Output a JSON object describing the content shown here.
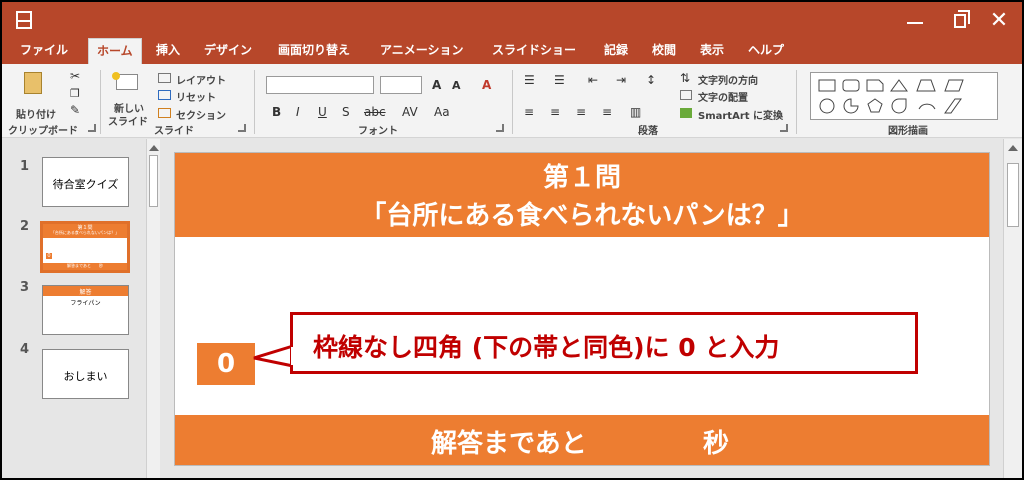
{
  "window": {
    "close_glyph": "✕"
  },
  "tabs": [
    {
      "label": "ファイル",
      "active": false
    },
    {
      "label": "ホーム",
      "active": true
    },
    {
      "label": "挿入",
      "active": false
    },
    {
      "label": "デザイン",
      "active": false
    },
    {
      "label": "画面切り替え",
      "active": false
    },
    {
      "label": "アニメーション",
      "active": false
    },
    {
      "label": "スライドショー",
      "active": false
    },
    {
      "label": "記録",
      "active": false
    },
    {
      "label": "校閲",
      "active": false
    },
    {
      "label": "表示",
      "active": false
    },
    {
      "label": "ヘルプ",
      "active": false
    }
  ],
  "ribbon": {
    "clipboard": {
      "paste_label": "貼り付け",
      "group_label": "クリップボード"
    },
    "slides": {
      "new_slide_line1": "新しい",
      "new_slide_line2": "スライド",
      "layout_label": "レイアウト",
      "reset_label": "リセット",
      "section_label": "セクション",
      "group_label": "スライド"
    },
    "font": {
      "grow_label": "A",
      "shrink_label": "A",
      "clear_label": "A",
      "bold": "B",
      "italic": "I",
      "underline": "U",
      "shadow": "S",
      "strike": "abc",
      "spacing": "AV",
      "case": "Aa",
      "group_label": "フォント"
    },
    "paragraph": {
      "text_direction_label": "文字列の方向",
      "align_text_label": "文字の配置",
      "smartart_label": "SmartArt に変換",
      "group_label": "段落"
    },
    "drawing": {
      "group_label": "図形描画"
    }
  },
  "thumbnails": [
    {
      "num": "1",
      "text": "待合室クイズ"
    },
    {
      "num": "2",
      "title": "第１問",
      "subtitle": "「台所にある食べられないパンは？」",
      "box": "0",
      "footer": "解答まであと　　秒"
    },
    {
      "num": "3",
      "title": "解答",
      "text": "フライパン"
    },
    {
      "num": "4",
      "text": "おしまい"
    }
  ],
  "slide": {
    "title_line1": "第１問",
    "title_line2": "「台所にある食べられないパンは？」",
    "zero_value": "0",
    "footer_text": "解答まであと",
    "footer_unit": "秒",
    "accent_color": "#ed7d31"
  },
  "callout": {
    "text": "枠線なし四角 (下の帯と同色)に 0 と入力",
    "color": "#c00000"
  },
  "colors": {
    "title_bar": "#b7472a"
  }
}
